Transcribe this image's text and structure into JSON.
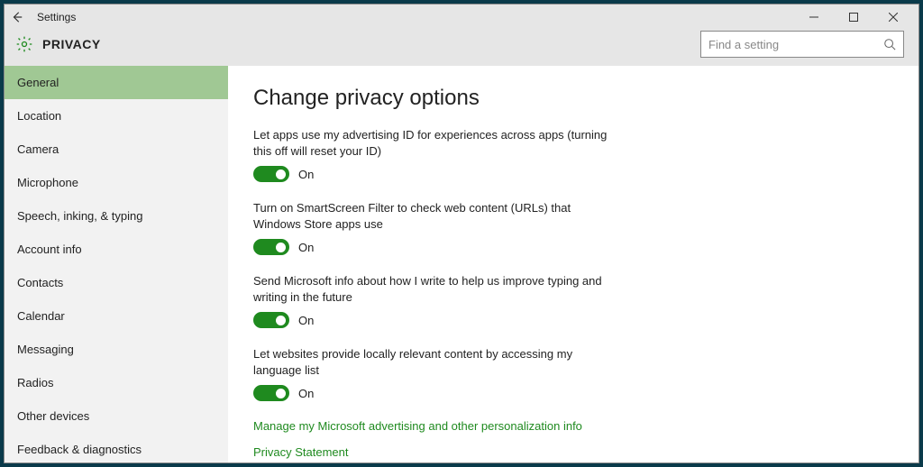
{
  "titlebar": {
    "back": "←",
    "title": "Settings"
  },
  "header": {
    "title": "PRIVACY",
    "search_placeholder": "Find a setting"
  },
  "sidebar": {
    "items": [
      {
        "label": "General",
        "active": true
      },
      {
        "label": "Location",
        "active": false
      },
      {
        "label": "Camera",
        "active": false
      },
      {
        "label": "Microphone",
        "active": false
      },
      {
        "label": "Speech, inking, & typing",
        "active": false
      },
      {
        "label": "Account info",
        "active": false
      },
      {
        "label": "Contacts",
        "active": false
      },
      {
        "label": "Calendar",
        "active": false
      },
      {
        "label": "Messaging",
        "active": false
      },
      {
        "label": "Radios",
        "active": false
      },
      {
        "label": "Other devices",
        "active": false
      },
      {
        "label": "Feedback & diagnostics",
        "active": false
      }
    ]
  },
  "content": {
    "heading": "Change privacy options",
    "options": [
      {
        "label": "Let apps use my advertising ID for experiences across apps (turning this off will reset your ID)",
        "state": "On"
      },
      {
        "label": "Turn on SmartScreen Filter to check web content (URLs) that Windows Store apps use",
        "state": "On"
      },
      {
        "label": "Send Microsoft info about how I write to help us improve typing and writing in the future",
        "state": "On"
      },
      {
        "label": "Let websites provide locally relevant content by accessing my language list",
        "state": "On"
      }
    ],
    "links": [
      "Manage my Microsoft advertising and other personalization info",
      "Privacy Statement"
    ]
  },
  "colors": {
    "accent": "#1f8a1f",
    "sidebar_active": "#a0c894"
  }
}
